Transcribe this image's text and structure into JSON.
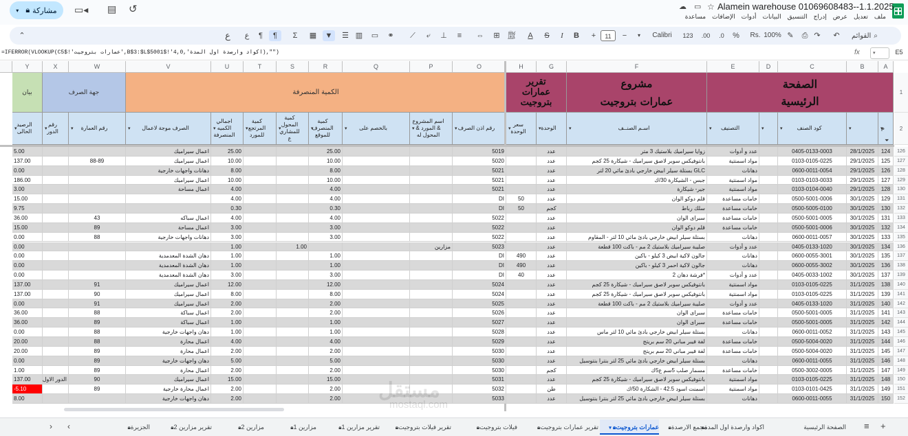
{
  "doc": {
    "title": "Alamein warehouse 01069608483--1.1.2025",
    "menus": [
      "ملف",
      "تعديل",
      "عرض",
      "إدراج",
      "التنسيق",
      "البيانات",
      "أدوات",
      "الإضافات",
      "مساعدة"
    ],
    "share_label": "مشاركة"
  },
  "toolbar": {
    "search_label": "القوائم",
    "zoom": "100%",
    "currency": "Rs.",
    "percent": "%",
    "dec_less": ".0",
    "dec_more": ".00",
    "num_format": "123",
    "font": "Calibri",
    "font_size": "11",
    "minus": "−",
    "plus": "+"
  },
  "formula_bar": {
    "cell_ref": "E5",
    "fx": "fx",
    "formula": "=IFERROR(VLOOKUP(C5$!'عمارات بتروجيت',B$3:$L$5001$!'اكواد وارصدة اول المدة',4,0),\"\")"
  },
  "columns": [
    "A",
    "B",
    "C",
    "D",
    "E",
    "F",
    "G",
    "H",
    "O",
    "P",
    "Q",
    "R",
    "S",
    "T",
    "U",
    "V",
    "W",
    "X",
    "Y"
  ],
  "header_banner": {
    "home": [
      "الصفحة",
      "الرئيسية"
    ],
    "project": [
      "مشروع",
      "عمارات بتروجيت"
    ],
    "report": [
      "تقرير",
      "عمارات",
      "بتروجيت"
    ],
    "qty_spent": "الكمية المنصرفة",
    "spend_party": "جهة الصرف",
    "statement": "بيان"
  },
  "header_fields": {
    "m": "م",
    "date": "",
    "code": "كود الصنف",
    "d_empty": "",
    "category": "التصنيف",
    "item_name": "اسـم الصنــف",
    "unit": "الوحدة",
    "unit_price": "سعر الوحدة",
    "permit": "رقم اذن الصرف",
    "project_name": "اسم المشروع & المورد & المحول له",
    "deduct": "بالخصم على",
    "qty_site": "كمية المنصرف للموقع",
    "qty_transfer": "كمية المحول للمشاري ع",
    "qty_return": "كمية المرتجع للمورد",
    "total_spent": "اجمالي الكميه المنصرفة",
    "spend_for": "الصرف موجة لاعمال",
    "building": "رقم العمارة",
    "floor": "رقم الدور",
    "balance": "الرصيد الحالى"
  },
  "rows": [
    [
      "126",
      "124",
      "28/1/2025",
      "0405-0133-0003",
      "عدد و أدوات",
      "زوايا سيراميك بلاستيك 3 متر",
      "عدد",
      "",
      "5019",
      "",
      "",
      "25.00",
      "",
      "",
      "25.00",
      "اعمال سيراميك",
      "",
      "",
      "5.00"
    ],
    [
      "127",
      "125",
      "29/1/2025",
      "0103-0105-0225",
      "مواد اسمنتية",
      "بانتوفيكس سوبر لاصق سيراميك - شيكارة 25 كجم",
      "عدد",
      "",
      "5020",
      "",
      "",
      "10.00",
      "",
      "",
      "10.00",
      "اعمال سيراميك",
      "88-89",
      "",
      "137.00"
    ],
    [
      "128",
      "126",
      "29/1/2025",
      "0600-0011-0054",
      "دهانات",
      "GLC بستلة سيلر ابيض خارجي بادئ مائي 20 لتر",
      "عدد",
      "",
      "5021",
      "",
      "",
      "8.00",
      "",
      "",
      "8.00",
      "دهانات واجهات خارجية",
      "",
      "",
      "0.00"
    ],
    [
      "129",
      "127",
      "29/1/2025",
      "0103-0103-0033",
      "مواد اسمنتية",
      "جبس - الشيكارة 30/ك",
      "عدد",
      "",
      "5021",
      "",
      "",
      "10.00",
      "",
      "",
      "10.00",
      "اعمال سيراميك",
      "",
      "",
      "186.00"
    ],
    [
      "130",
      "128",
      "29/1/2025",
      "0103-0104-0040",
      "مواد اسمنتية",
      "جير- شيكارة",
      "عدد",
      "",
      "5021",
      "",
      "",
      "4.00",
      "",
      "",
      "4.00",
      "اعمال مساحة",
      "",
      "",
      "3.00"
    ],
    [
      "131",
      "129",
      "30/1/2025",
      "0500-5001-0006",
      "خامات مساعدة",
      "قلم دوكو الوان",
      "عدد",
      "50",
      "DI",
      "",
      "",
      "4.00",
      "",
      "",
      "4.00",
      "",
      "",
      "",
      "15.00"
    ],
    [
      "132",
      "130",
      "30/1/2025",
      "0500-5005-0100",
      "خامات مساعدة",
      "سلك رباط",
      "كجم",
      "50",
      "DI",
      "",
      "",
      "0.30",
      "",
      "",
      "0.30",
      "",
      "",
      "",
      "9.75"
    ],
    [
      "133",
      "131",
      "30/1/2025",
      "0500-5001-0005",
      "خامات مساعدة",
      "سبراى الوان",
      "عدد",
      "",
      "5022",
      "",
      "",
      "4.00",
      "",
      "",
      "4.00",
      "اعمال سباكه",
      "43",
      "",
      "36.00"
    ],
    [
      "134",
      "132",
      "30/1/2025",
      "0500-5001-0006",
      "خامات مساعدة",
      "قلم دوكو الوان",
      "عدد",
      "",
      "5022",
      "",
      "",
      "3.00",
      "",
      "",
      "3.00",
      "اعمال مساحة",
      "89",
      "",
      "15.00"
    ],
    [
      "135",
      "133",
      "30/1/2025",
      "0600-0011-0057",
      "دهانات",
      "بستلة سيلر ابيض خارجي بادئ مائي 10 لتر - المقاوم",
      "عدد",
      "",
      "5022",
      "",
      "",
      "3.00",
      "",
      "",
      "3.00",
      "دهانات واجهات خارجية",
      "88",
      "",
      "0.00"
    ],
    [
      "136",
      "134",
      "30/1/2025",
      "0405-0133-1020",
      "عدد و أدوات",
      "صليبة سيراميك بلاستيك 2 مم - باكت 100 قطعة",
      "عدد",
      "",
      "5023",
      "مزارين",
      "",
      "",
      "1.00",
      "",
      "1.00",
      "",
      "",
      "",
      "0.00"
    ],
    [
      "137",
      "135",
      "30/1/2025",
      "0600-0055-3001",
      "دهانات",
      "جالون لاكية ابيض 3 كيلو - باكين",
      "عدد",
      "490",
      "DI",
      "",
      "",
      "1.00",
      "",
      "",
      "1.00",
      "دهان الشدة المعدمدية",
      "",
      "",
      "0.00"
    ],
    [
      "138",
      "136",
      "30/1/2025",
      "0600-0055-3002",
      "دهانات",
      "جالون لاكية احمر 3 كيلو - باكين",
      "عدد",
      "490",
      "DI",
      "",
      "",
      "1.00",
      "",
      "",
      "1.00",
      "دهان الشدة المعدمدية",
      "",
      "",
      "0.00"
    ],
    [
      "139",
      "137",
      "30/1/2025",
      "0405-0033-1002",
      "عدد و أدوات",
      "*فرشة دهان 2",
      "عدد",
      "40",
      "DI",
      "",
      "",
      "3.00",
      "",
      "",
      "3.00",
      "دهان الشدة المعدمدية",
      "",
      "",
      "0.00"
    ],
    [
      "140",
      "138",
      "31/1/2025",
      "0103-0105-0225",
      "مواد اسمنتية",
      "بانتوفيكس سوبر لاصق سيراميك - شيكارة 25 كجم",
      "عدد",
      "",
      "5024",
      "",
      "",
      "12.00",
      "",
      "",
      "12.00",
      "اعمال سيراميك",
      "91",
      "",
      "137.00"
    ],
    [
      "141",
      "139",
      "31/1/2025",
      "0103-0105-0225",
      "مواد اسمنتية",
      "بانتوفيكس سوبر لاصق سيراميك - شيكارة 25 كجم",
      "عدد",
      "",
      "5024",
      "",
      "",
      "8.00",
      "",
      "",
      "8.00",
      "اعمال سيراميك",
      "90",
      "",
      "137.00"
    ],
    [
      "142",
      "140",
      "31/1/2025",
      "0405-0133-1020",
      "عدد و أدوات",
      "صليبة سيراميك بلاستيك 2 مم - باكت 100 قطعة",
      "عدد",
      "",
      "5025",
      "",
      "",
      "2.00",
      "",
      "",
      "2.00",
      "اعمال سيراميك",
      "91",
      "",
      "0.00"
    ],
    [
      "143",
      "141",
      "31/1/2025",
      "0500-5001-0005",
      "خامات مساعدة",
      "سبراى الوان",
      "عدد",
      "",
      "5026",
      "",
      "",
      "2.00",
      "",
      "",
      "2.00",
      "اعمال سباكة",
      "88",
      "",
      "36.00"
    ],
    [
      "144",
      "142",
      "31/1/2025",
      "0500-5001-0005",
      "خامات مساعدة",
      "سبراى الوان",
      "عدد",
      "",
      "5027",
      "",
      "",
      "1.00",
      "",
      "",
      "1.00",
      "اعمال سباكة",
      "89",
      "",
      "36.00"
    ],
    [
      "145",
      "143",
      "31/1/2025",
      "0600-0011-0052",
      "دهانات",
      "بستلة سيلر ابيض خارجي بادئ مائي 10 لتر ماس",
      "عدد",
      "",
      "5028",
      "",
      "",
      "1.00",
      "",
      "",
      "1.00",
      "دهان واجهات خارجية",
      "88",
      "",
      "0.00"
    ],
    [
      "146",
      "144",
      "31/1/2025",
      "0500-5004-0020",
      "خامات مساعدة",
      "لفة فيبر مباني 20 سم بريتج",
      "عدد",
      "",
      "5029",
      "",
      "",
      "4.00",
      "",
      "",
      "4.00",
      "اعمال محارة",
      "88",
      "",
      "20.00"
    ],
    [
      "147",
      "145",
      "31/1/2025",
      "0500-5004-0020",
      "خامات مساعدة",
      "لفة فيبر مباني 20 سم بريتج",
      "عدد",
      "",
      "5030",
      "",
      "",
      "2.00",
      "",
      "",
      "2.00",
      "اعمال محارة",
      "89",
      "",
      "20.00"
    ],
    [
      "148",
      "146",
      "31/1/2025",
      "0600-0011-0055",
      "دهانات",
      "بستلة سيلر ابيض خارجي بادئ مائي 25 لتر بنترا بنتوسيل",
      "عدد",
      "",
      "5030",
      "",
      "",
      "5.00",
      "",
      "",
      "5.00",
      "دهان واجهات خارجية",
      "89",
      "",
      "0.00"
    ],
    [
      "149",
      "147",
      "31/1/2025",
      "0500-3002-0005",
      "خامات مساعدة",
      "مسمار صلب 5سم ع5ك",
      "كجم",
      "",
      "5030",
      "",
      "",
      "2.00",
      "",
      "",
      "2.00",
      "اعمال محارة",
      "89",
      "",
      "1.00"
    ],
    [
      "150",
      "148",
      "31/1/2025",
      "0103-0105-0225",
      "مواد اسمنتية",
      "بانتوفيكس سوبر لاصق سيراميك - شيكارة 25 كجم",
      "عدد",
      "",
      "5031",
      "",
      "",
      "15.00",
      "",
      "",
      "15.00",
      "اعمال سيراميك",
      "90",
      "الدور الاول",
      "137.00"
    ],
    [
      "151",
      "149",
      "31/1/2025",
      "0103-0101-0425",
      "مواد اسمنتية",
      "اسمنت اسود 42.5 - الشكارة 50/ك",
      "طن",
      "",
      "5032",
      "",
      "",
      "2.00",
      "",
      "",
      "2.00",
      "اعمال محارة خارجية",
      "89",
      "",
      "-5.10"
    ],
    [
      "152",
      "150",
      "31/1/2025",
      "0600-0011-0055",
      "دهانات",
      "بستلة سيلر ابيض خارجي بادئ مائي 25 لتر بنترا بنتوسيل",
      "عدد",
      "",
      "5033",
      "",
      "",
      "2.00",
      "",
      "",
      "2.00",
      "دهان واجهات خارجية",
      "",
      "",
      "8.00"
    ]
  ],
  "sheet_tabs": [
    "الصفحة الرئيسية",
    "اكواد وارصدة اول المدة",
    "مجمع الارصدة",
    "عمارات بتروجيت",
    "تقرير عمارات بتروجيت",
    "فيلات بتروجيت",
    "تقرير فيلات بتروجيت",
    "تقرير مزارين 1",
    "مزارين 1",
    "مزارين 2",
    "تقرير مزارين 2",
    "الجزيرة"
  ],
  "active_tab": "عمارات بتروجيت",
  "watermark": "mostaql.com",
  "colors": {
    "header_purple": "#a9446a",
    "header_orange": "#f4b183",
    "header_blue": "#b4c7e7",
    "header_green": "#c6e0b4",
    "field_blue": "#cfe2f3",
    "row_gray": "#d9d9d9",
    "negative_red": "#ff0000",
    "active_tab": "#0b57d0"
  }
}
